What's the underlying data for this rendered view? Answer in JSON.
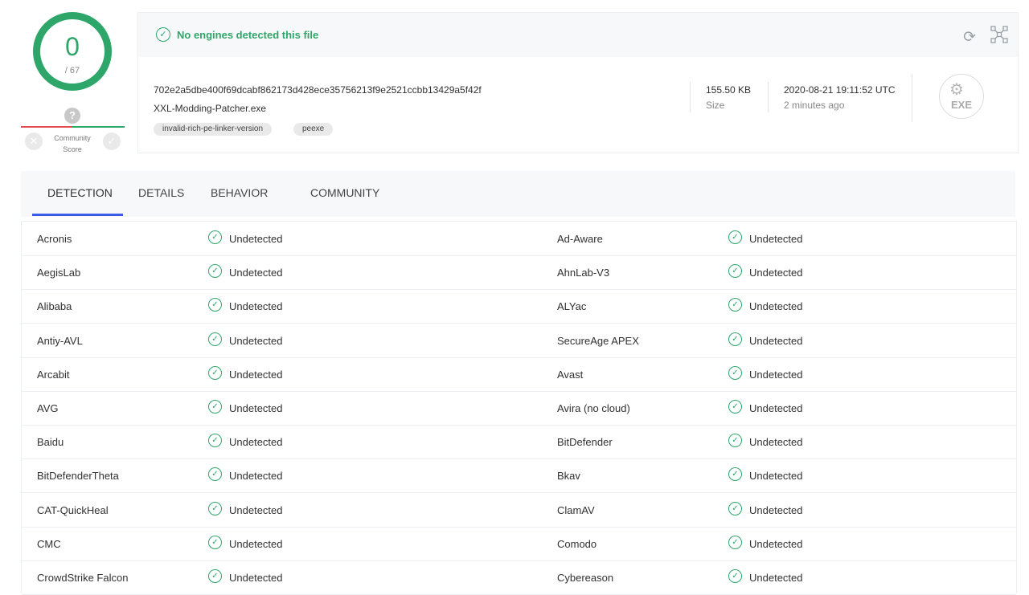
{
  "score": {
    "detected": "0",
    "total": "/ 67"
  },
  "community": {
    "label_line1": "Community",
    "label_line2": "Score",
    "question": "?"
  },
  "status": {
    "text": "No engines detected this file",
    "color": "#2ea66a"
  },
  "file": {
    "hash": "702e2a5dbe400f69dcabf862173d428ece35756213f9e2521ccbb13429a5f42f",
    "name": "XXL-Modding-Patcher.exe",
    "tags": [
      "invalid-rich-pe-linker-version",
      "peexe"
    ],
    "size_value": "155.50 KB",
    "size_label": "Size",
    "date_value": "2020-08-21 19:11:52 UTC",
    "date_label": "2 minutes ago",
    "type_badge": "EXE"
  },
  "icons": {
    "status": "check-circle-icon",
    "reload": "reload-icon",
    "graph": "graph-icon",
    "filetype": "exe-file-icon"
  },
  "tabs": [
    "DETECTION",
    "DETAILS",
    "BEHAVIOR",
    "COMMUNITY"
  ],
  "accent": "#3b5ce6",
  "detections": [
    {
      "left": "Acronis",
      "left_result": "Undetected",
      "right": "Ad-Aware",
      "right_result": "Undetected"
    },
    {
      "left": "AegisLab",
      "left_result": "Undetected",
      "right": "AhnLab-V3",
      "right_result": "Undetected"
    },
    {
      "left": "Alibaba",
      "left_result": "Undetected",
      "right": "ALYac",
      "right_result": "Undetected"
    },
    {
      "left": "Antiy-AVL",
      "left_result": "Undetected",
      "right": "SecureAge APEX",
      "right_result": "Undetected"
    },
    {
      "left": "Arcabit",
      "left_result": "Undetected",
      "right": "Avast",
      "right_result": "Undetected"
    },
    {
      "left": "AVG",
      "left_result": "Undetected",
      "right": "Avira (no cloud)",
      "right_result": "Undetected"
    },
    {
      "left": "Baidu",
      "left_result": "Undetected",
      "right": "BitDefender",
      "right_result": "Undetected"
    },
    {
      "left": "BitDefenderTheta",
      "left_result": "Undetected",
      "right": "Bkav",
      "right_result": "Undetected"
    },
    {
      "left": "CAT-QuickHeal",
      "left_result": "Undetected",
      "right": "ClamAV",
      "right_result": "Undetected"
    },
    {
      "left": "CMC",
      "left_result": "Undetected",
      "right": "Comodo",
      "right_result": "Undetected"
    },
    {
      "left": "CrowdStrike Falcon",
      "left_result": "Undetected",
      "right": "Cybereason",
      "right_result": "Undetected"
    }
  ]
}
